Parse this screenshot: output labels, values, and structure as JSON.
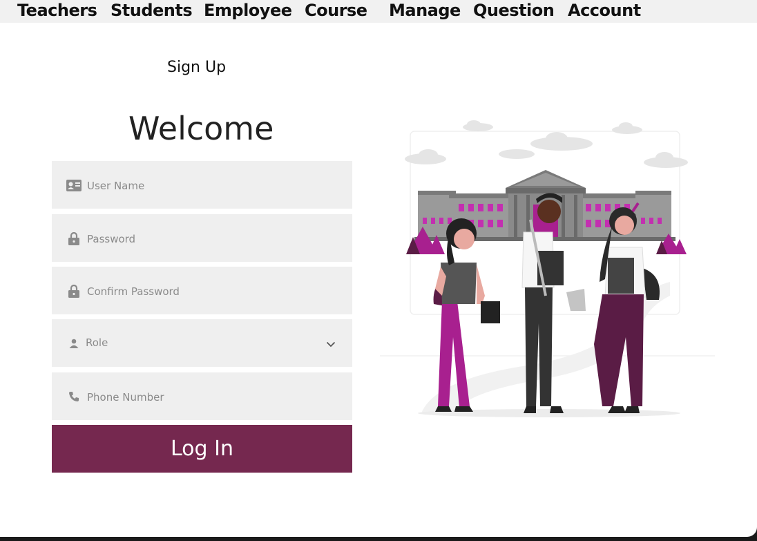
{
  "nav": {
    "items": [
      "Teachers",
      "Students",
      "Employee",
      "Course",
      "Manage",
      "Question",
      "Account"
    ]
  },
  "form": {
    "header": "Sign Up",
    "title": "Welcome",
    "fields": {
      "username": {
        "placeholder": "User Name",
        "icon": "id-card-icon"
      },
      "password": {
        "placeholder": "Password",
        "icon": "lock-icon"
      },
      "confirm_password": {
        "placeholder": "Confirm Password",
        "icon": "lock-icon"
      },
      "role": {
        "label": "Role",
        "icon": "person-icon"
      },
      "phone": {
        "placeholder": "Phone Number",
        "icon": "phone-icon"
      }
    },
    "submit_label": "Log In"
  },
  "colors": {
    "accent": "#75284f",
    "magenta": "#a8208f",
    "field_bg": "#efefef",
    "nav_bg": "#f1f1f1"
  }
}
